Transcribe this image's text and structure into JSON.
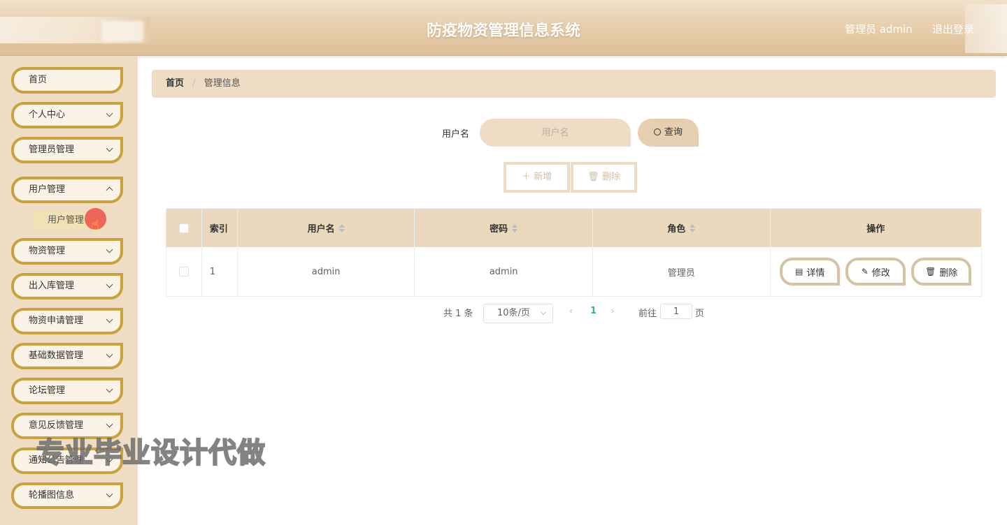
{
  "header": {
    "title": "防疫物资管理信息系统",
    "user": "管理员 admin",
    "logout": "退出登录"
  },
  "sidebar": {
    "items": [
      {
        "label": "首页"
      },
      {
        "label": "个人中心"
      },
      {
        "label": "管理员管理"
      },
      {
        "label": "用户管理"
      },
      {
        "label": "物资管理"
      },
      {
        "label": "出入库管理"
      },
      {
        "label": "物资申请管理"
      },
      {
        "label": "基础数据管理"
      },
      {
        "label": "论坛管理"
      },
      {
        "label": "意见反馈管理"
      },
      {
        "label": "通知公告管理"
      },
      {
        "label": "轮播图信息"
      }
    ],
    "active_sub": "用户管理"
  },
  "breadcrumb": {
    "home": "首页",
    "separator": "/",
    "current": "管理信息"
  },
  "search": {
    "label": "用户名",
    "placeholder": "用户名",
    "value": "",
    "button": "查询"
  },
  "actions": {
    "add": "新增",
    "delete": "删除"
  },
  "table": {
    "headers": {
      "index": "索引",
      "username": "用户名",
      "password": "密码",
      "role": "角色",
      "ops": "操作"
    },
    "rows": [
      {
        "index": "1",
        "username": "admin",
        "password": "admin",
        "role": "管理员"
      }
    ],
    "ops": {
      "detail": "详情",
      "edit": "修改",
      "delete": "删除"
    }
  },
  "pagination": {
    "total": "共 1 条",
    "page_size": "10条/页",
    "current": "1",
    "goto_label": "前往",
    "goto_value": "1",
    "page_unit": "页"
  },
  "watermark": "专业毕业设计代做",
  "colors": {
    "accent": "#c9a23c",
    "panel": "#eedcc4",
    "table_header": "#ead9bd",
    "page_active": "#2db7a2"
  }
}
